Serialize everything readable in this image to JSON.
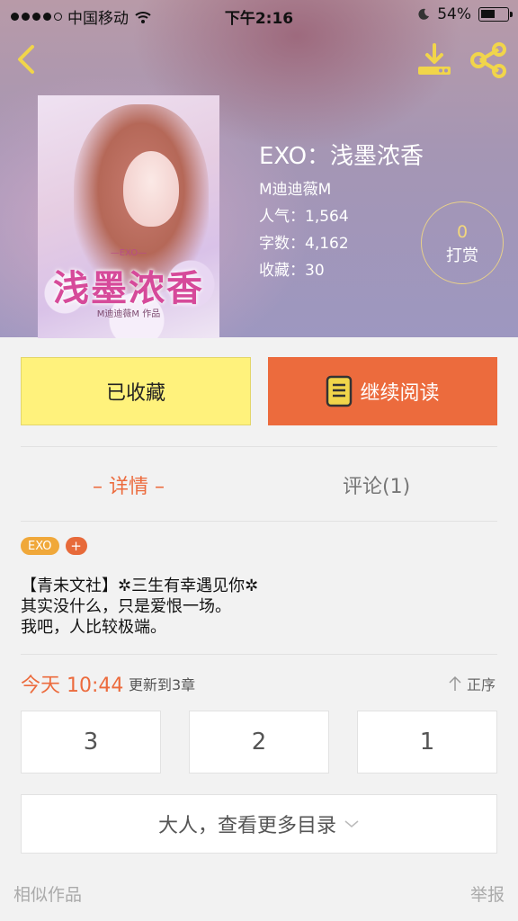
{
  "status_bar": {
    "carrier": "中国移动",
    "time": "下午2:16",
    "battery": "54%",
    "battery_level": 0.54
  },
  "book": {
    "cover_series": "—EXO—",
    "cover_title": "浅墨浓香",
    "cover_author": "M迪迪薇M 作品",
    "title": "EXO：浅墨浓香",
    "author": "M迪迪薇M",
    "popularity": "人气：1,564",
    "words": "字数：4,162",
    "favorites": "收藏：30"
  },
  "tip": {
    "count": "0",
    "label": "打赏"
  },
  "actions": {
    "saved_label": "已收藏",
    "read_label": "继续阅读"
  },
  "tabs": {
    "detail": "– 详情 –",
    "comments": "评论(1)"
  },
  "tags": {
    "items": [
      "EXO"
    ],
    "add": "+"
  },
  "description": {
    "line1": "【青未文社】✲三生有幸遇见你✲",
    "line2": "其实没什么，只是爱恨一场。",
    "line3": "我吧，人比较极端。"
  },
  "updates": {
    "time": "今天 10:44",
    "text": "更新到3章",
    "sort_label": "正序"
  },
  "chapters": [
    "3",
    "2",
    "1"
  ],
  "more_label": "大人，查看更多目录",
  "footer": {
    "similar": "相似作品",
    "report": "举报"
  },
  "colors": {
    "accent": "#ec6b3d",
    "saved_button": "#fff27c",
    "tag": "#f0a83a",
    "tip_ring": "#e8d08a"
  },
  "icons": {
    "back": "chevron-left-icon",
    "download": "download-icon",
    "share": "share-icon",
    "book": "book-icon",
    "sort": "arrow-up-icon",
    "more": "chevron-down-icon"
  }
}
